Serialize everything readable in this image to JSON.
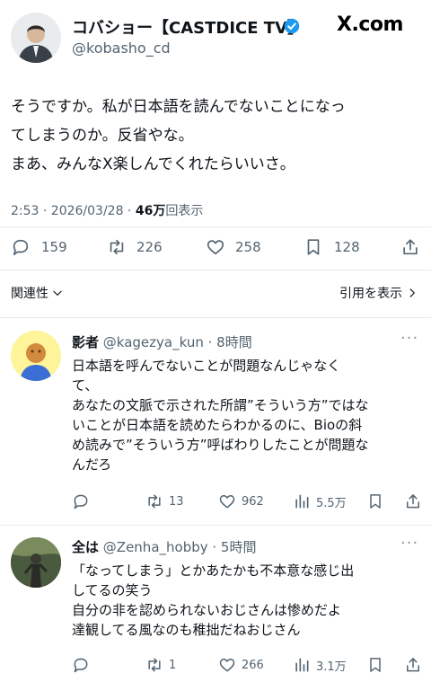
{
  "header": {
    "display_name": "コバショー【CASTDICE TV】",
    "handle": "@kobasho_cd",
    "brand": "X.com"
  },
  "main_post": {
    "lines": [
      "そうですか。私が日本語を読んでないことになっ",
      "てしまうのか。反省やな。",
      "まあ、みんなX楽しんでくれたらいいさ。"
    ],
    "time_date": "2:53 · 2026/03/28 · ",
    "views_value": "46万",
    "views_label": "回表示",
    "actions": {
      "replies": "159",
      "reposts": "226",
      "likes": "258",
      "bookmarks": "128"
    }
  },
  "filters": {
    "relevance": "関連性",
    "quotes": "引用を表示"
  },
  "replies": [
    {
      "name": "影者",
      "meta": "@kagezya_kun · 8時間",
      "lines": [
        "日本語を呼んでないことが問題なんじゃなく",
        "て、",
        "あなたの文脈で示された所謂”そういう方”ではな",
        "いことが日本語を読めたらわかるのに、Bioの斜",
        "め読みで”そういう方”呼ばわりしたことが問題な",
        "んだろ"
      ],
      "actions": {
        "reposts": "13",
        "likes": "962",
        "views": "5.5万"
      }
    },
    {
      "name": "全は",
      "meta": "@Zenha_hobby · 5時間",
      "lines": [
        "「なってしまう」とかあたかも不本意な感じ出",
        "してるの笑う",
        "自分の非を認められないおじさんは惨めだよ",
        "達観してる風なのも稚拙だねおじさん"
      ],
      "actions": {
        "reposts": "1",
        "likes": "266",
        "views": "3.1万"
      }
    }
  ],
  "colors": {
    "verified": "#1d9bf0",
    "text": "#0f1419",
    "muted": "#536471"
  }
}
